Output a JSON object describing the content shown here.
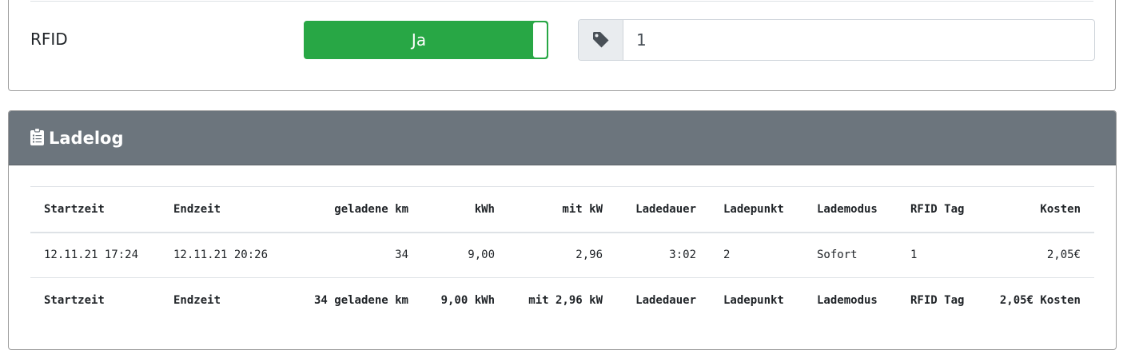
{
  "rfid": {
    "label": "RFID",
    "toggle_label": "Ja",
    "tag_value": "1",
    "tag_icon": "tag-icon"
  },
  "ladelog": {
    "title": "Ladelog",
    "icon": "clipboard-icon",
    "columns": [
      "Startzeit",
      "Endzeit",
      "geladene km",
      "kWh",
      "mit kW",
      "Ladedauer",
      "Ladepunkt",
      "Lademodus",
      "RFID Tag",
      "Kosten"
    ],
    "rows": [
      [
        "12.11.21 17:24",
        "12.11.21 20:26",
        "34",
        "9,00",
        "2,96",
        "3:02",
        "2",
        "Sofort",
        "1",
        "2,05€"
      ]
    ],
    "footer": [
      "Startzeit",
      "Endzeit",
      "34 geladene km",
      "9,00 kWh",
      "mit 2,96 kW",
      "Ladedauer",
      "Ladepunkt",
      "Lademodus",
      "RFID Tag",
      "2,05€ Kosten"
    ]
  },
  "colors": {
    "toggle_on": "#28a745",
    "header_bg": "#6c757d"
  }
}
